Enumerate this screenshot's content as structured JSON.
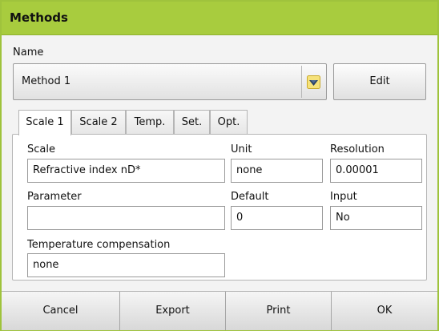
{
  "window": {
    "title": "Methods",
    "accent_color": "#a8cc3e"
  },
  "name_section": {
    "label": "Name",
    "selected_method": "Method 1",
    "dropdown_icon": "chevron-down-icon",
    "edit_label": "Edit"
  },
  "tabs": [
    {
      "label": "Scale 1",
      "active": true
    },
    {
      "label": "Scale 2",
      "active": false
    },
    {
      "label": "Temp.",
      "active": false
    },
    {
      "label": "Set.",
      "active": false
    },
    {
      "label": "Opt.",
      "active": false
    }
  ],
  "form": {
    "scale": {
      "label": "Scale",
      "value": "Refractive index nD*"
    },
    "unit": {
      "label": "Unit",
      "value": "none"
    },
    "resolution": {
      "label": "Resolution",
      "value": "0.00001"
    },
    "parameter": {
      "label": "Parameter",
      "value": ""
    },
    "default": {
      "label": "Default",
      "value": "0"
    },
    "input": {
      "label": "Input",
      "value": "No"
    },
    "temperature_compensation": {
      "label": "Temperature compensation",
      "value": "none"
    }
  },
  "footer": {
    "cancel": "Cancel",
    "export": "Export",
    "print": "Print",
    "ok": "OK"
  }
}
